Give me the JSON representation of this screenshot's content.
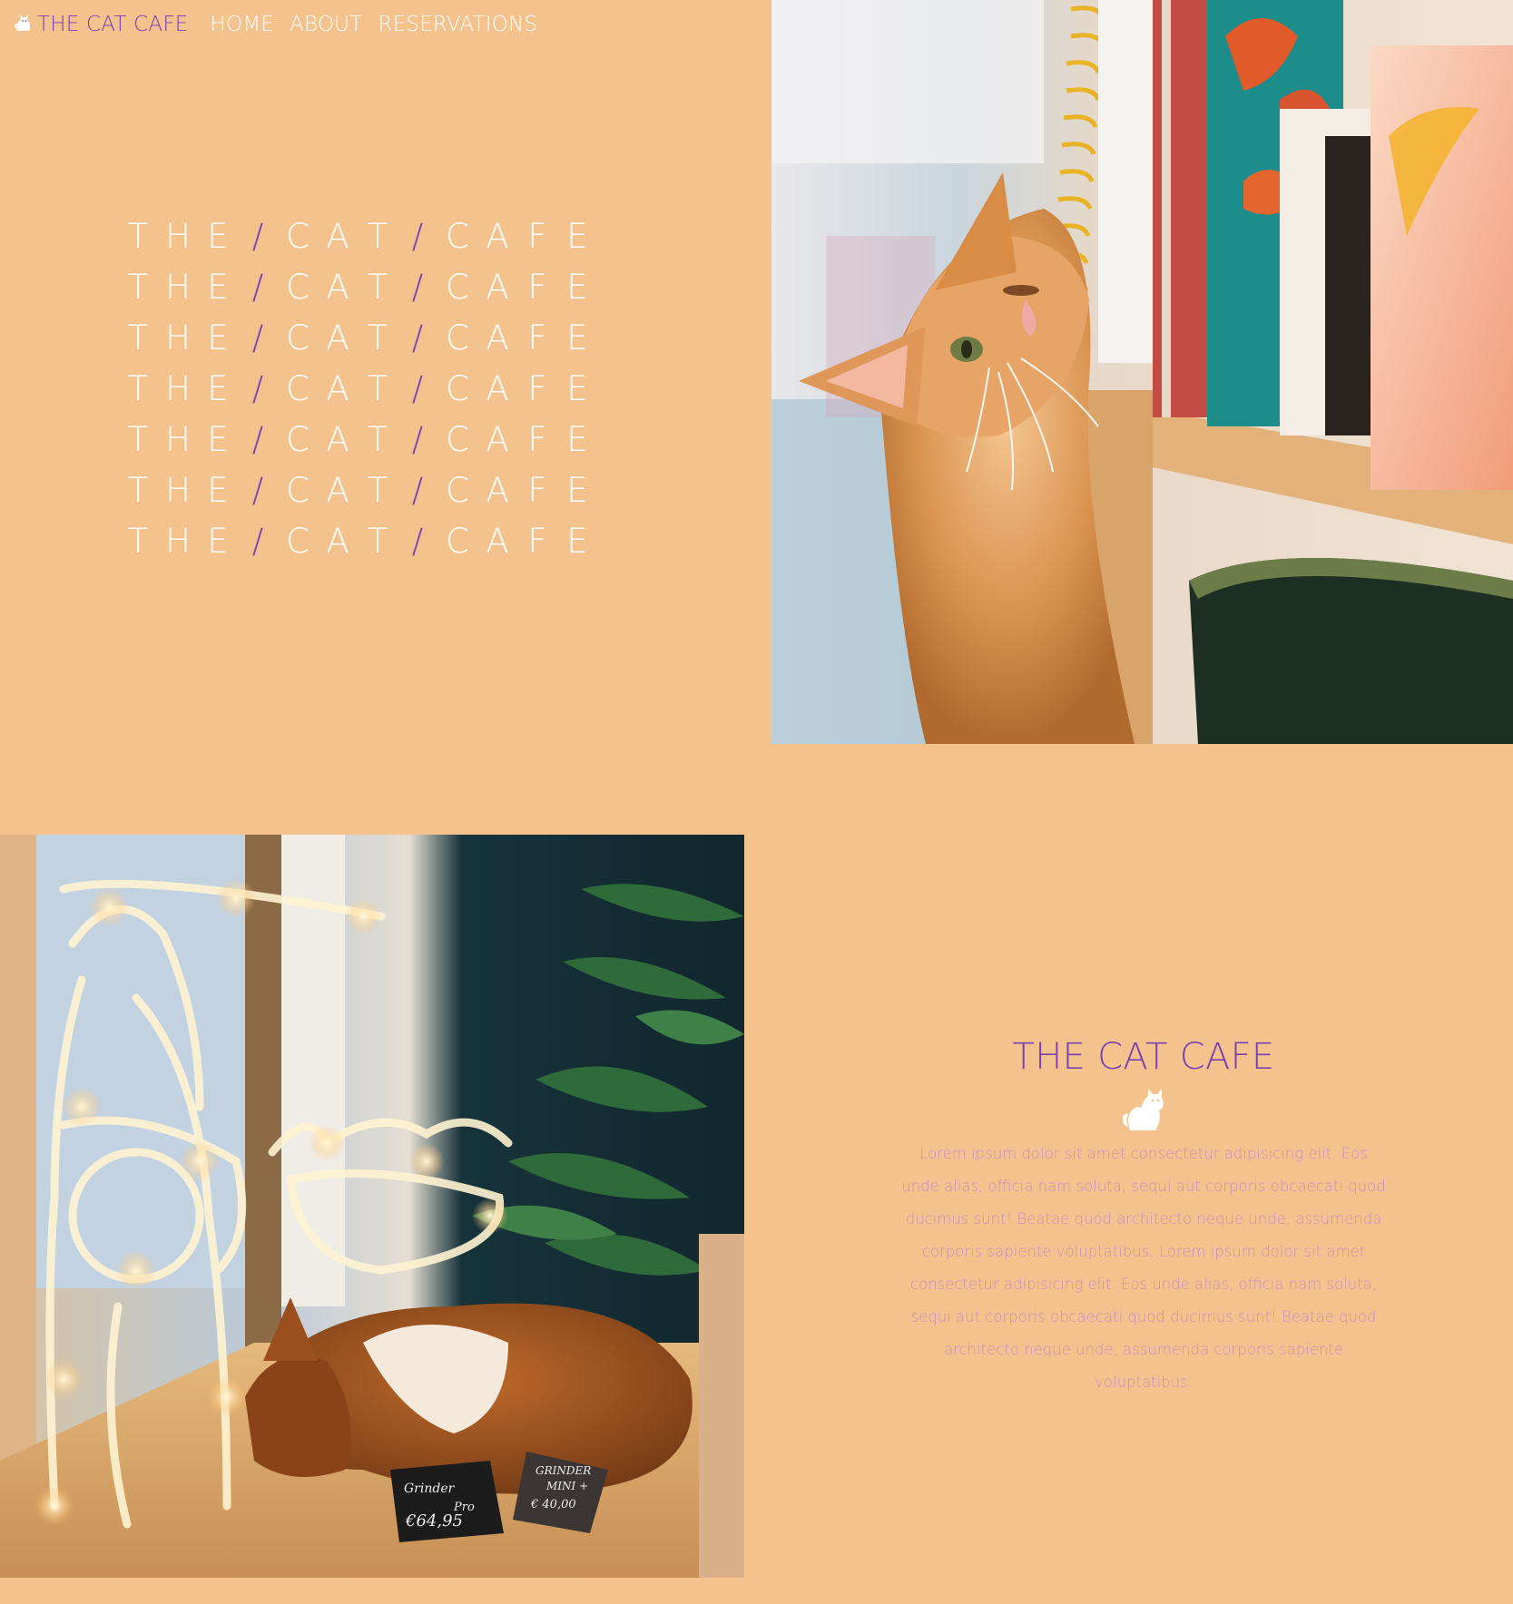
{
  "nav": {
    "brand_label": "THE CAT CAFE",
    "brand_icon": "cat-icon",
    "links": [
      "HOME",
      "ABOUT",
      "RESERVATIONS"
    ]
  },
  "hero": {
    "word1": "THE",
    "word2": "CAT",
    "word3": "CAFE",
    "separator": "/"
  },
  "photos": {
    "top": "cat-rubbing-notebook-photo",
    "bottom": "cat-sleeping-by-lights-photo",
    "sign1_line1": "Grinder",
    "sign1_line2": "Pro",
    "sign1_price": "€64,95",
    "sign2_line1": "GRINDER",
    "sign2_line2": "MINI +",
    "sign2_price": "€ 40,00"
  },
  "about": {
    "title": "THE CAT CAFE",
    "icon": "cat-icon",
    "text": "Lorem ipsum dolor sit amet consectetur adipisicing elit. Eos unde alias, officia nam soluta, sequi aut corporis obcaecati quod ducimus sunt! Beatae quod architecto neque unde, assumenda corporis sapiente voluptatibus. Lorem ipsum dolor sit amet consectetur adipisicing elit. Eos unde alias, officia nam soluta, sequi aut corporis obcaecati quod ducimus sunt! Beatae quod architecto neque unde, assumenda corporis sapiente voluptatibus."
  },
  "colors": {
    "background": "#f4c28d",
    "accent": "#7b3fb0",
    "body_text": "#c890c0",
    "hero_text": "#ffffff"
  }
}
